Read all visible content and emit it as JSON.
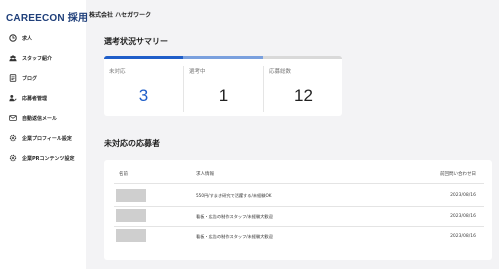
{
  "app": {
    "logo": "CAREECON 採用",
    "company": "株式会社 ハセガワーク"
  },
  "sidebar": {
    "items": [
      {
        "label": "求人",
        "icon": "clock-icon"
      },
      {
        "label": "スタッフ紹介",
        "icon": "people-icon"
      },
      {
        "label": "ブログ",
        "icon": "document-icon"
      },
      {
        "label": "応募者管理",
        "icon": "user-edit-icon"
      },
      {
        "label": "自動返信メール",
        "icon": "mail-icon"
      },
      {
        "label": "企業プロフィール設定",
        "icon": "gear-icon"
      },
      {
        "label": "企業PRコンテンツ設定",
        "icon": "gear-icon"
      }
    ]
  },
  "summary": {
    "title": "選考状況サマリー",
    "progress": [
      0.33,
      0.67,
      1.0
    ],
    "stats": [
      {
        "label": "未対応",
        "value": "3"
      },
      {
        "label": "選考中",
        "value": "1"
      },
      {
        "label": "応募総数",
        "value": "12"
      }
    ]
  },
  "applicants": {
    "title": "未対応の応募者",
    "headers": {
      "name": "名前",
      "job": "求人情報",
      "date": "前回問い合わせ日"
    },
    "rows": [
      {
        "job": "550円/すまき研究で活躍する/未経験OK",
        "date": "2023/08/16"
      },
      {
        "job": "看板・広告の制作スタッフ/未経験大歓迎",
        "date": "2023/08/16"
      },
      {
        "job": "看板・広告の制作スタッフ/未経験大歓迎",
        "date": "2023/08/16"
      }
    ]
  },
  "colors": {
    "accent": "#1f5ec9",
    "accent_light": "#7aa0de",
    "brand": "#1f3f7a"
  }
}
